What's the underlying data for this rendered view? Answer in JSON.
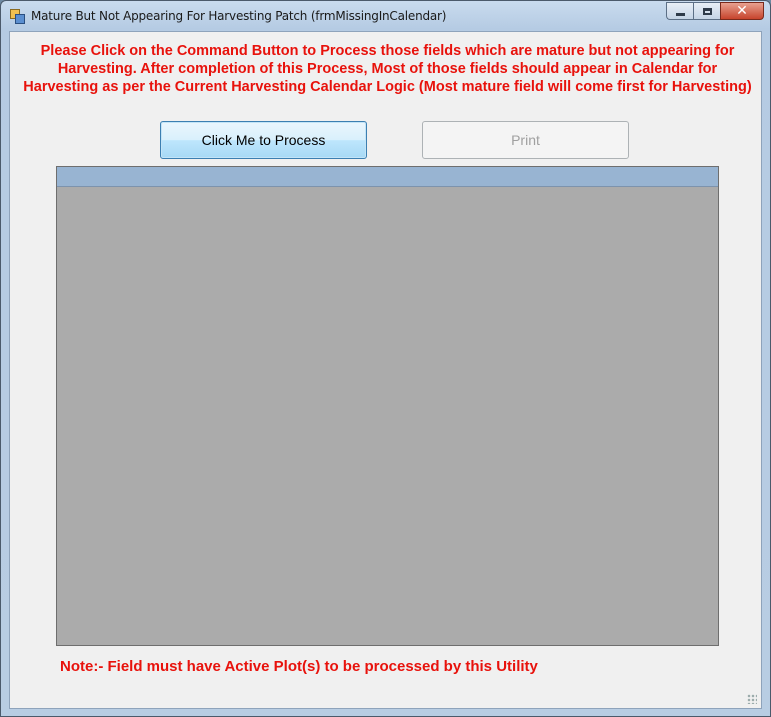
{
  "window": {
    "title": "Mature But Not Appearing For Harvesting Patch (frmMissingInCalendar)",
    "icons": {
      "app": "app-form-icon",
      "minimize": "minimize-icon",
      "maximize": "maximize-icon",
      "close": "close-icon"
    },
    "close_glyph": "✕"
  },
  "form": {
    "message": "Please Click on the Command Button to Process those fields which are mature but not appearing for Harvesting. After completion of this Process, Most of those fields should appear in Calendar for Harvesting as per the Current Harvesting Calendar Logic (Most mature field will come first for Harvesting)",
    "process_button": "Click Me to Process",
    "print_button": "Print",
    "print_enabled": false,
    "note": "Note:- Field must have Active Plot(s) to be processed by this Utility"
  },
  "colors": {
    "message_text": "#e8120c",
    "grid_background": "#ababab",
    "grid_header": "#98b4d2",
    "client_background": "#f0f0f0"
  }
}
